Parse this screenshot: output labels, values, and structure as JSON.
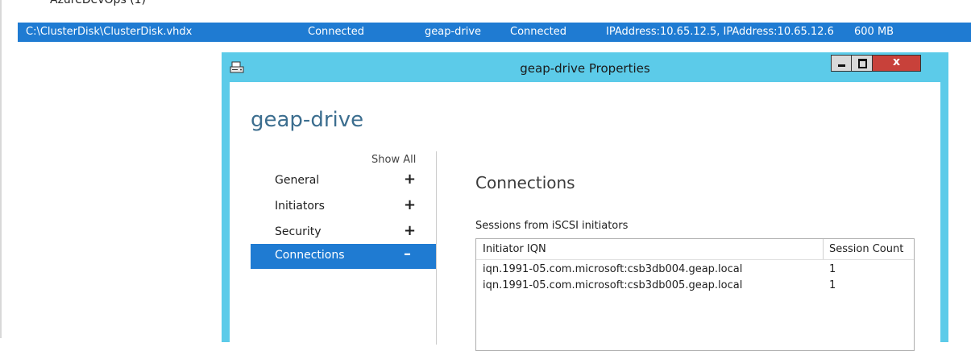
{
  "background": {
    "tree_item": "AzureDevOps (1)",
    "selected_row": {
      "path": "C:\\ClusterDisk\\ClusterDisk.vhdx",
      "status": "Connected",
      "target": "geap-drive",
      "target_status": "Connected",
      "ip_addresses": "IPAddress:10.65.12.5, IPAddress:10.65.12.6",
      "size": "600 MB"
    }
  },
  "window": {
    "title": "geap-drive Properties",
    "icon": "disk-properties-icon",
    "close_label": "x",
    "heading": "geap-drive",
    "show_all": "Show All",
    "nav": [
      {
        "label": "General",
        "sign": "+"
      },
      {
        "label": "Initiators",
        "sign": "+"
      },
      {
        "label": "Security",
        "sign": "+"
      },
      {
        "label": "Connections",
        "sign": "–"
      }
    ],
    "section_title": "Connections",
    "sessions_label": "Sessions from iSCSI initiators",
    "grid": {
      "columns": [
        "Initiator IQN",
        "Session Count"
      ],
      "rows": [
        {
          "iqn": "iqn.1991-05.com.microsoft:csb3db004.geap.local",
          "count": "1"
        },
        {
          "iqn": "iqn.1991-05.com.microsoft:csb3db005.geap.local",
          "count": "1"
        }
      ]
    }
  },
  "colors": {
    "selection": "#1f7bd2",
    "window_frame": "#5ccbe9",
    "heading": "#3c6e8f",
    "close_button": "#c8413a"
  }
}
